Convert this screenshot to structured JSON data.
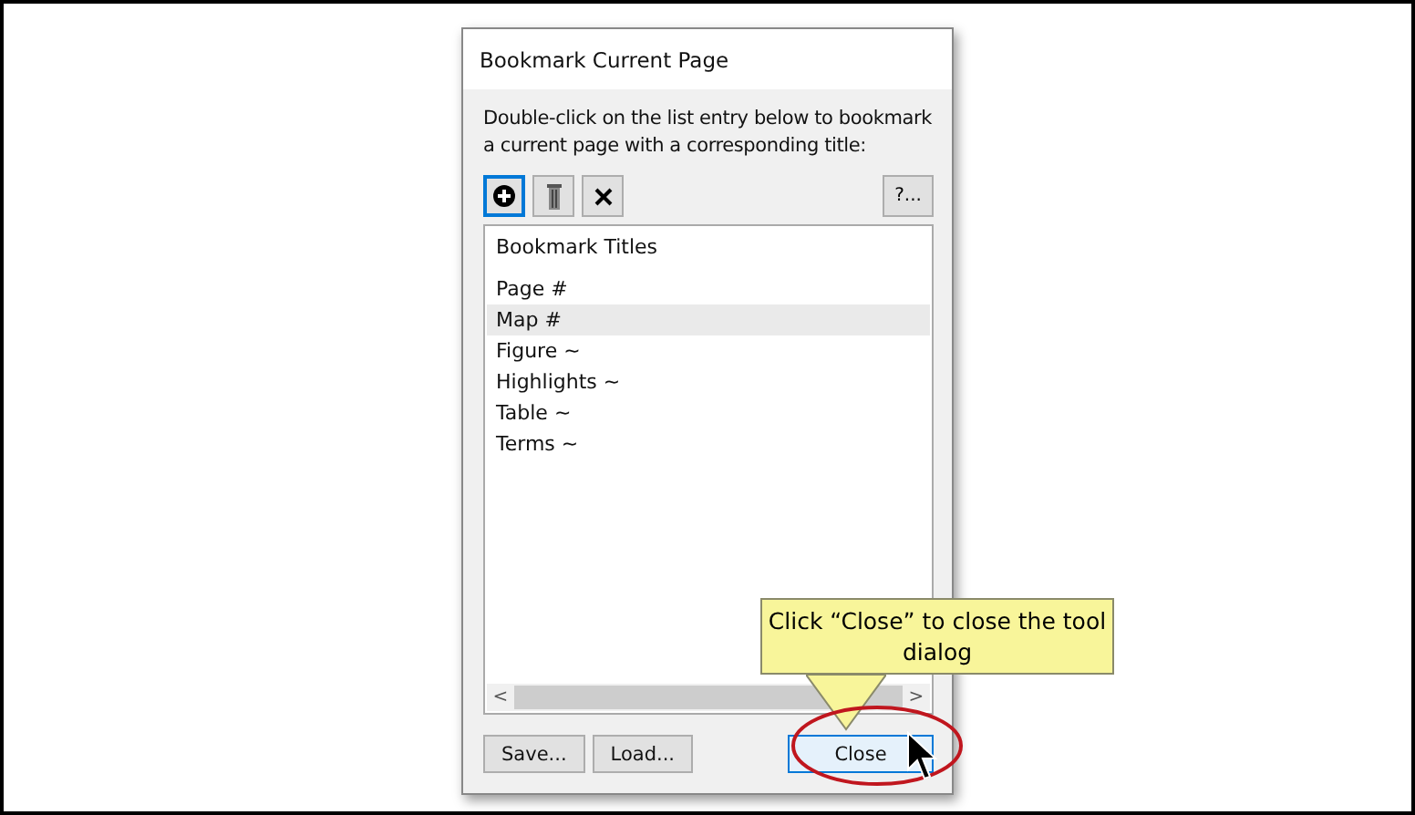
{
  "window": {
    "title": "Bookmark Current Page"
  },
  "instruction": "Double-click on the list entry below to bookmark a current page with a corresponding title:",
  "toolbar": [
    {
      "kind": "add",
      "selected": true
    },
    {
      "kind": "delete",
      "selected": false
    },
    {
      "kind": "clear",
      "selected": false
    }
  ],
  "help_button": "?...",
  "list": {
    "header": "Bookmark Titles",
    "items": [
      {
        "label": "Page #",
        "selected": false
      },
      {
        "label": "Map #",
        "selected": true
      },
      {
        "label": "Figure ~",
        "selected": false
      },
      {
        "label": "Highlights ~",
        "selected": false
      },
      {
        "label": "Table ~",
        "selected": false
      },
      {
        "label": "Terms ~",
        "selected": false
      }
    ]
  },
  "scrollbar": {
    "left": "<",
    "right": ">"
  },
  "buttons": [
    {
      "label": "Save...",
      "kind": "normal"
    },
    {
      "label": "Load...",
      "kind": "normal"
    },
    {
      "label": "Close",
      "kind": "default"
    }
  ],
  "callout": "Click “Close” to close the tool dialog"
}
